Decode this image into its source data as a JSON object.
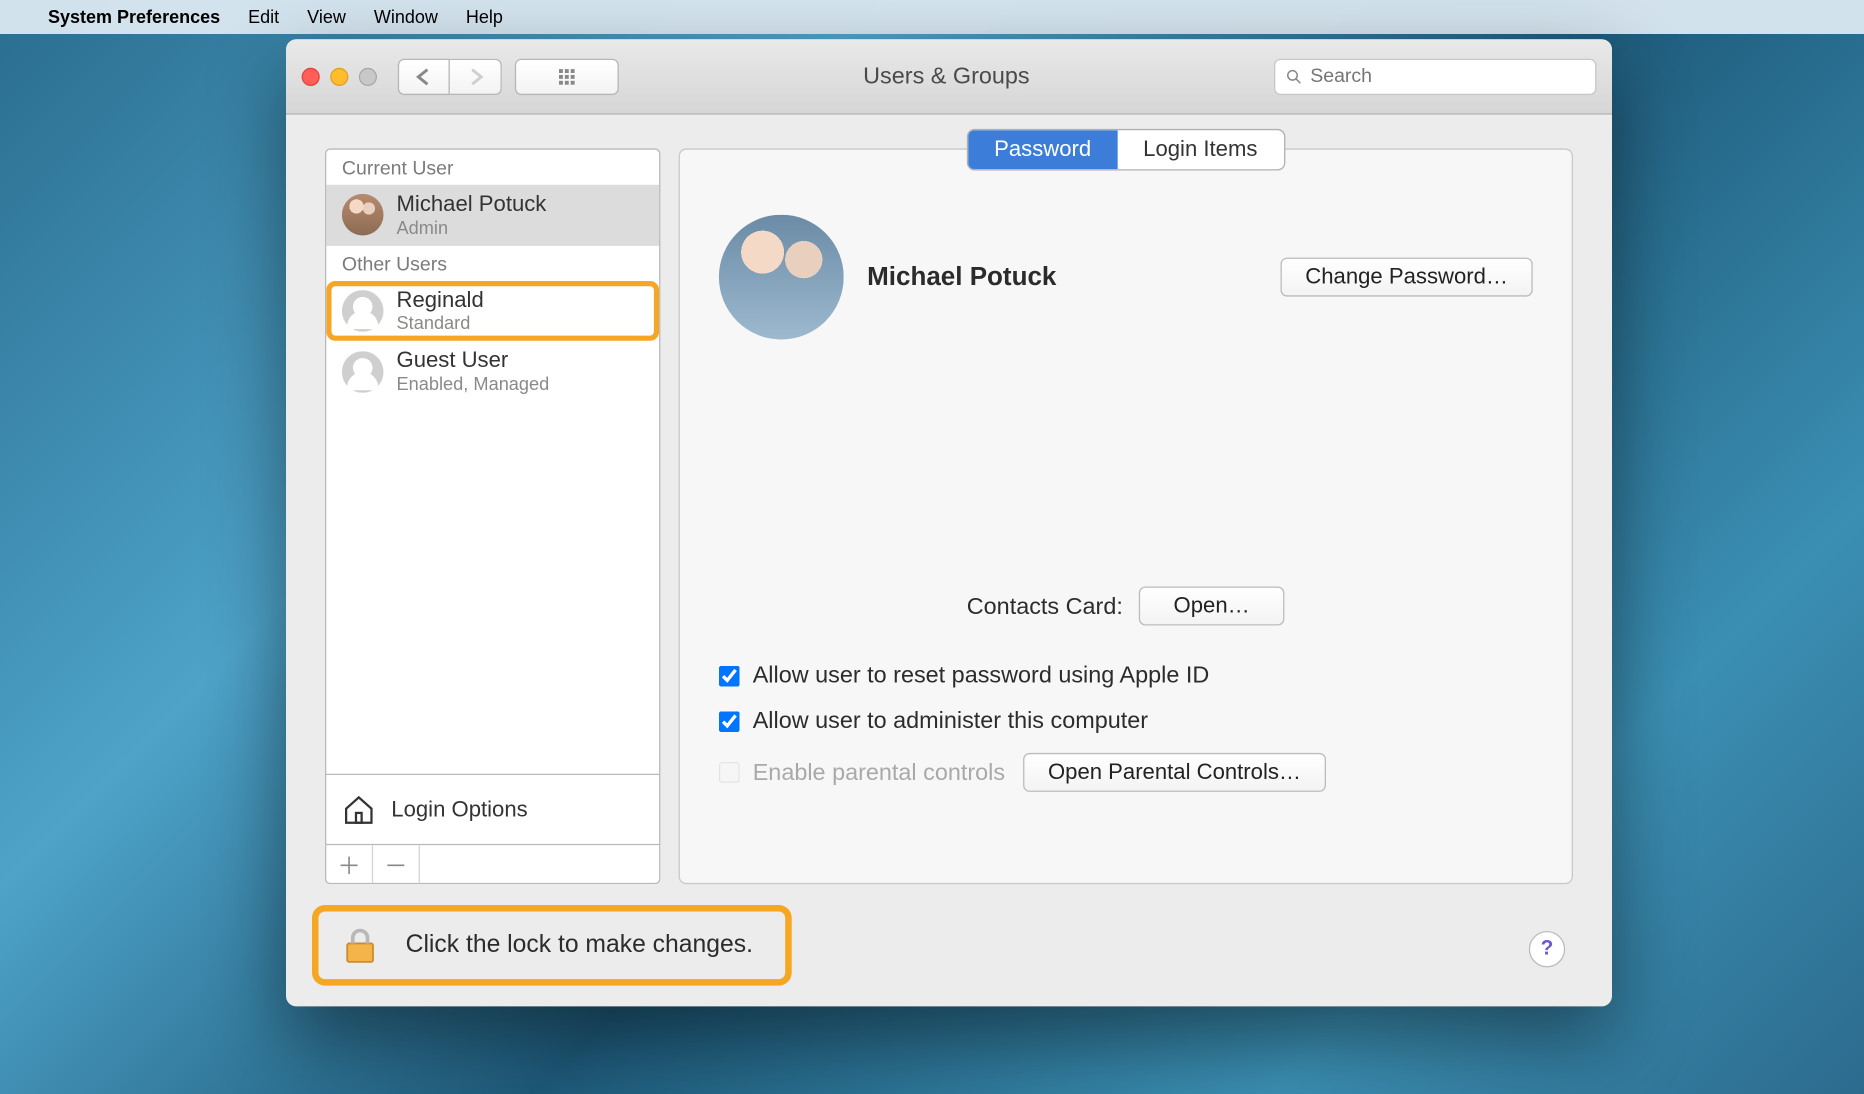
{
  "menubar": {
    "app": "System Preferences",
    "items": [
      "Edit",
      "View",
      "Window",
      "Help"
    ]
  },
  "window": {
    "title": "Users & Groups",
    "search_placeholder": "Search"
  },
  "sidebar": {
    "current_header": "Current User",
    "other_header": "Other Users",
    "current": {
      "name": "Michael Potuck",
      "role": "Admin"
    },
    "others": [
      {
        "name": "Reginald",
        "role": "Standard",
        "highlighted": true
      },
      {
        "name": "Guest User",
        "role": "Enabled, Managed",
        "highlighted": false
      }
    ],
    "login_options": "Login Options"
  },
  "tabs": {
    "password": "Password",
    "login_items": "Login Items",
    "active": "password"
  },
  "panel": {
    "display_name": "Michael Potuck",
    "change_password_btn": "Change Password…",
    "contacts_card_label": "Contacts Card:",
    "open_btn": "Open…",
    "allow_reset": "Allow user to reset password using Apple ID",
    "allow_admin": "Allow user to administer this computer",
    "parental_label": "Enable parental controls",
    "parental_btn": "Open Parental Controls…",
    "allow_reset_checked": true,
    "allow_admin_checked": true,
    "parental_checked": false
  },
  "footer": {
    "lock_text": "Click the lock to make changes.",
    "help": "?"
  }
}
